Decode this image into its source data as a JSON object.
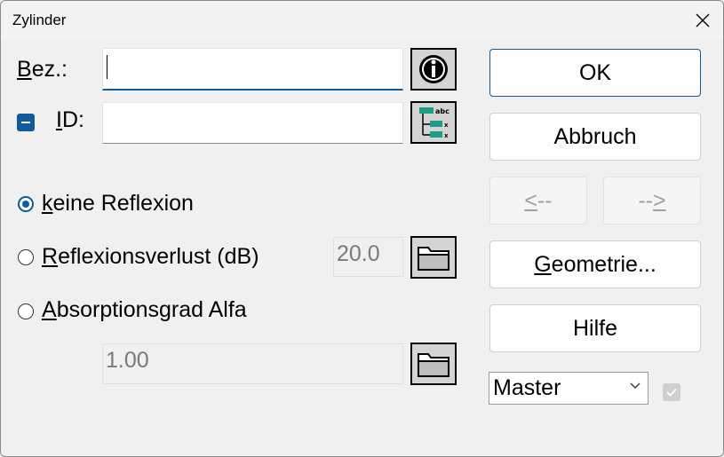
{
  "window": {
    "title": "Zylinder"
  },
  "bez": {
    "label_first": "B",
    "label_rest": "ez.:",
    "value": ""
  },
  "id": {
    "label_first": "I",
    "label_rest": "D:",
    "value": ""
  },
  "options": {
    "keine": {
      "first": "k",
      "rest": "eine Reflexion",
      "checked": true
    },
    "reflexionsverlust": {
      "first": "R",
      "rest": "eflexionsverlust (dB)",
      "value": "20.0"
    },
    "absorption": {
      "first": "A",
      "rest": "bsorptionsgrad Alfa",
      "value": "1.00"
    }
  },
  "buttons": {
    "ok": "OK",
    "abbruch": "Abbruch",
    "prev_first": "<",
    "prev_rest": "--",
    "next_rest": "--",
    "next_last": ">",
    "geometrie_first": "G",
    "geometrie_rest": "eometrie...",
    "hilfe": "Hilfe"
  },
  "dropdown": {
    "selected": "Master"
  },
  "icons": {
    "info": "info-icon",
    "tree": "tree-list-icon",
    "folder": "folder-icon",
    "close": "close-icon"
  },
  "colors": {
    "accent": "#0f5b9c",
    "background": "#f0f0f0"
  }
}
